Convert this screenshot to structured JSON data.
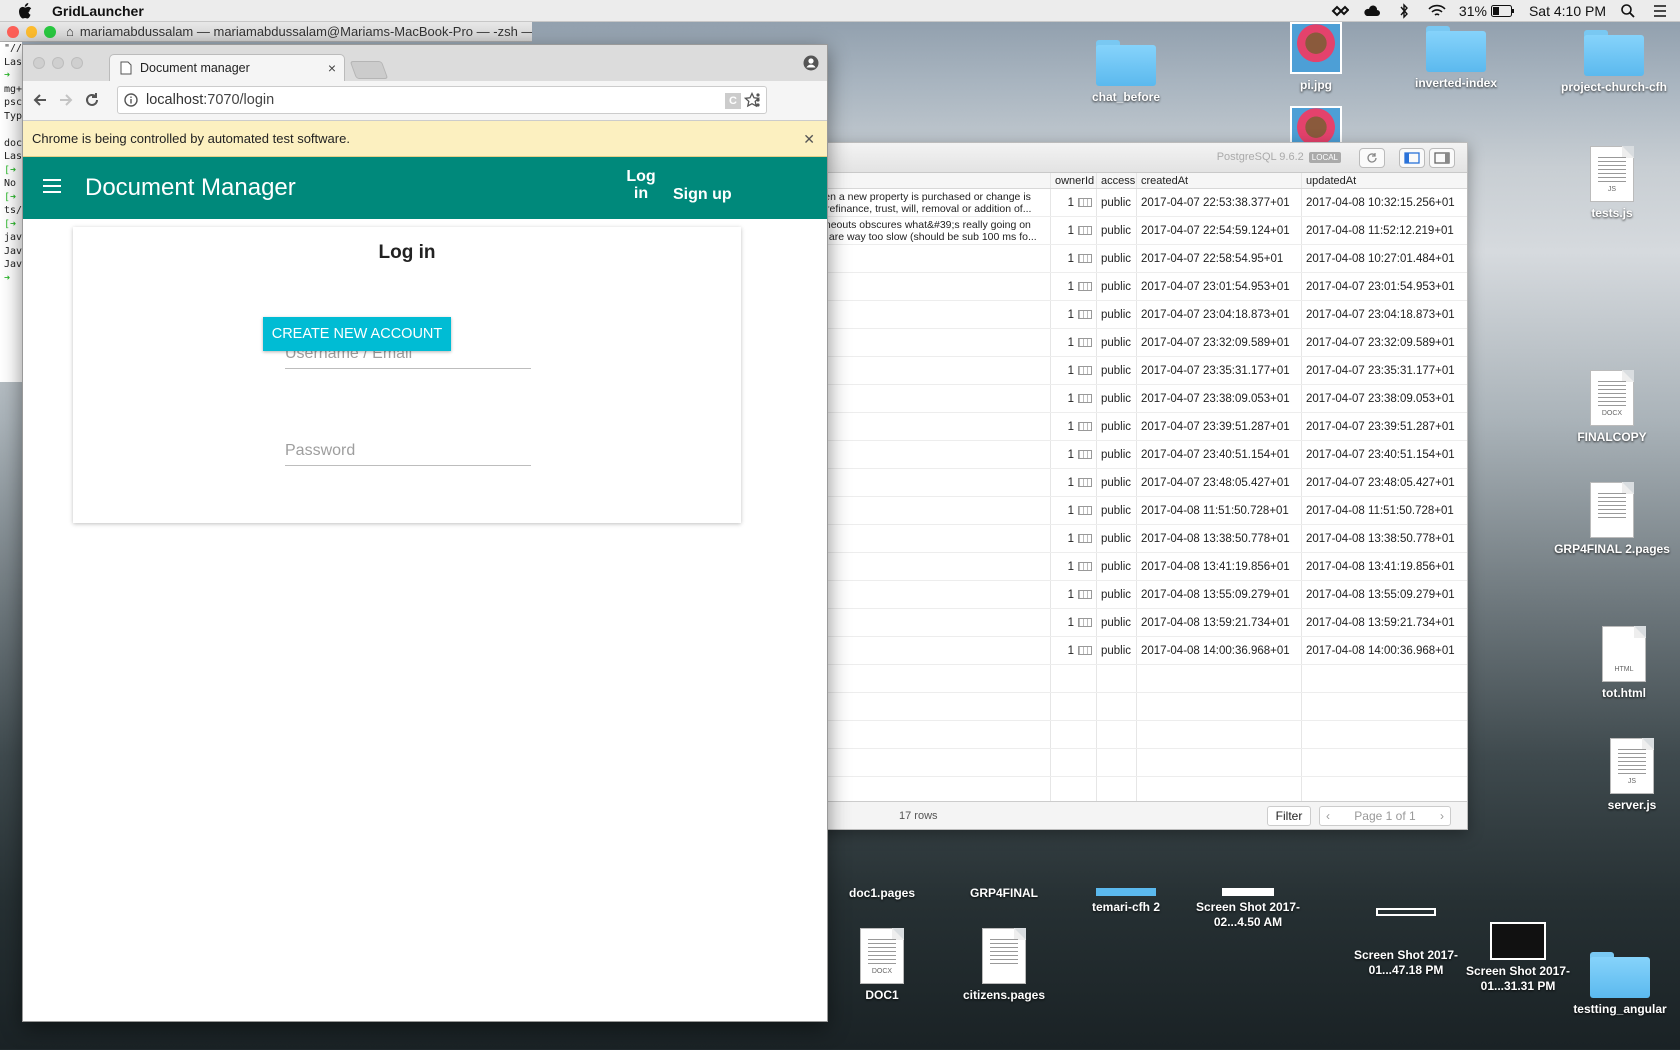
{
  "menubar": {
    "app_name": "GridLauncher",
    "battery": "31%",
    "clock": "Sat 4:10 PM"
  },
  "terminal": {
    "title": "mariamabdussalam — mariamabdussalam@Mariams-MacBook-Pro — -zsh —...",
    "lines": [
      "\"//",
      "Las",
      "➜",
      "mg+",
      "psc",
      "Typ",
      "",
      "doc",
      "Las",
      "[➜",
      "No",
      "[➜",
      "ts/",
      "[➜",
      "jav",
      "Jav",
      "Jav",
      "➜"
    ]
  },
  "desktop": {
    "icons": [
      {
        "label": "chat_before"
      },
      {
        "label": "pi.jpg"
      },
      {
        "label": "inverted-index"
      },
      {
        "label": "project-church-cfh"
      },
      {
        "label": "tests.js",
        "tag": "JS"
      },
      {
        "label": "FINALCOPY",
        "tag": "DOCX"
      },
      {
        "label": "GRP4FINAL 2.pages"
      },
      {
        "label": "tot.html",
        "tag": "HTML"
      },
      {
        "label": "server.js",
        "tag": "JS"
      },
      {
        "label": "doc1.pages"
      },
      {
        "label": "GRP4FINAL"
      },
      {
        "label": "temari-cfh 2"
      },
      {
        "label": "Screen Shot 2017-02...4.50 AM"
      },
      {
        "label": "Screen Shot 2017-01...47.18 PM"
      },
      {
        "label": "Screen Shot 2017-01...31.31 PM"
      },
      {
        "label": "DOC1",
        "tag": "DOCX"
      },
      {
        "label": "citizens.pages"
      },
      {
        "label": "testting_angular"
      }
    ]
  },
  "postgres": {
    "server_label": "PostgreSQL 9.6.2",
    "badge": "LOCAL",
    "columns": [
      "ownerId",
      "access",
      "createdAt",
      "updatedAt"
    ],
    "rows": [
      {
        "snippet1": "county when a new property is purchased or change is",
        "snippet2": "e change, refinance, trust, will, removal or addition of...",
        "owner": "1",
        "access": "public",
        "created": "2017-04-07 22:53:38.377+01",
        "updated": "2017-04-08 10:32:15.256+01"
      },
      {
        "snippet1": "sing the timeouts obscures what&#39;s really going on",
        "snippet2": "twork calls are way too slow (should be sub 100 ms fo...",
        "owner": "1",
        "access": "public",
        "created": "2017-04-07 22:54:59.124+01",
        "updated": "2017-04-08 11:52:12.219+01"
      },
      {
        "snippet1": "",
        "snippet2": "",
        "owner": "1",
        "access": "public",
        "created": "2017-04-07 22:58:54.95+01",
        "updated": "2017-04-08 10:27:01.484+01"
      },
      {
        "snippet1": "",
        "snippet2": "",
        "owner": "1",
        "access": "public",
        "created": "2017-04-07 23:01:54.953+01",
        "updated": "2017-04-07 23:01:54.953+01"
      },
      {
        "snippet1": "",
        "snippet2": "",
        "owner": "1",
        "access": "public",
        "created": "2017-04-07 23:04:18.873+01",
        "updated": "2017-04-07 23:04:18.873+01"
      },
      {
        "snippet1": "",
        "snippet2": "",
        "owner": "1",
        "access": "public",
        "created": "2017-04-07 23:32:09.589+01",
        "updated": "2017-04-07 23:32:09.589+01"
      },
      {
        "snippet1": "",
        "snippet2": "",
        "owner": "1",
        "access": "public",
        "created": "2017-04-07 23:35:31.177+01",
        "updated": "2017-04-07 23:35:31.177+01"
      },
      {
        "snippet1": "",
        "snippet2": "",
        "owner": "1",
        "access": "public",
        "created": "2017-04-07 23:38:09.053+01",
        "updated": "2017-04-07 23:38:09.053+01"
      },
      {
        "snippet1": "",
        "snippet2": "",
        "owner": "1",
        "access": "public",
        "created": "2017-04-07 23:39:51.287+01",
        "updated": "2017-04-07 23:39:51.287+01"
      },
      {
        "snippet1": "",
        "snippet2": "",
        "owner": "1",
        "access": "public",
        "created": "2017-04-07 23:40:51.154+01",
        "updated": "2017-04-07 23:40:51.154+01"
      },
      {
        "snippet1": "",
        "snippet2": "",
        "owner": "1",
        "access": "public",
        "created": "2017-04-07 23:48:05.427+01",
        "updated": "2017-04-07 23:48:05.427+01"
      },
      {
        "snippet1": "",
        "snippet2": "",
        "owner": "1",
        "access": "public",
        "created": "2017-04-08 11:51:50.728+01",
        "updated": "2017-04-08 11:51:50.728+01"
      },
      {
        "snippet1": "",
        "snippet2": "",
        "owner": "1",
        "access": "public",
        "created": "2017-04-08 13:38:50.778+01",
        "updated": "2017-04-08 13:38:50.778+01"
      },
      {
        "snippet1": "",
        "snippet2": "",
        "owner": "1",
        "access": "public",
        "created": "2017-04-08 13:41:19.856+01",
        "updated": "2017-04-08 13:41:19.856+01"
      },
      {
        "snippet1": "",
        "snippet2": "",
        "owner": "1",
        "access": "public",
        "created": "2017-04-08 13:55:09.279+01",
        "updated": "2017-04-08 13:55:09.279+01"
      },
      {
        "snippet1": "",
        "snippet2": "",
        "owner": "1",
        "access": "public",
        "created": "2017-04-08 13:59:21.734+01",
        "updated": "2017-04-08 13:59:21.734+01"
      },
      {
        "snippet1": "",
        "snippet2": "",
        "owner": "1",
        "access": "public",
        "created": "2017-04-08 14:00:36.968+01",
        "updated": "2017-04-08 14:00:36.968+01"
      }
    ],
    "footer": {
      "rows_count": "17 rows",
      "filter": "Filter",
      "page": "Page 1 of 1"
    }
  },
  "chrome": {
    "tab_title": "Document manager",
    "url_host": "localhost",
    "url_path": ":7070/login",
    "infobar": "Chrome is being controlled by automated test software."
  },
  "app": {
    "title": "Document Manager",
    "nav_login": "Log in",
    "nav_signup": "Sign up",
    "card_title": "Log in",
    "username_placeholder": "Username / Email",
    "password_placeholder": "Password",
    "create_button": "CREATE NEW ACCOUNT",
    "accent": "#00897b",
    "button_color": "#00bcd4"
  }
}
